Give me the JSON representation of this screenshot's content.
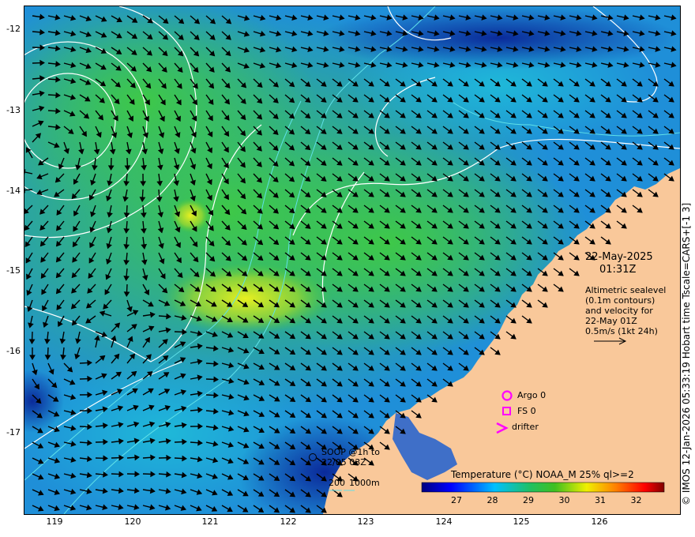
{
  "map": {
    "y_ticks": [
      "-12",
      "-13",
      "-14",
      "-15",
      "-16",
      "-17"
    ],
    "x_ticks": [
      "119",
      "120",
      "121",
      "122",
      "123",
      "124",
      "125",
      "126"
    ],
    "credit": "© IMOS 12-Jan-2026 05:33:19 Hobart time Tscale=CARS+[-1 3]",
    "date": "22-May-2025",
    "time": "01:31Z",
    "altimetry": {
      "line1": "Altimetric sealevel",
      "line2": "(0.1m contours)",
      "line3": "and velocity for",
      "line4": "22-May 01Z",
      "line5": "0.5m/s (1kt 24h)"
    },
    "legend": {
      "argo": "Argo 0",
      "fs": "FS 0",
      "drifter": "drifter"
    },
    "soop": {
      "line1": "SOOP @1h to",
      "line2": "22/05 03Z"
    },
    "depth": {
      "label_200": "200",
      "label_1000": "1000m"
    },
    "colorbar": {
      "title": "Temperature (°C) NOAA_M 25% ql>=2",
      "ticks": [
        "27",
        "28",
        "29",
        "30",
        "31",
        "32"
      ]
    },
    "colors": {
      "land": "#f9c89a",
      "argo": "#ff00ff",
      "contour": "#ffffff",
      "isobath": "#5fe0e8"
    }
  }
}
